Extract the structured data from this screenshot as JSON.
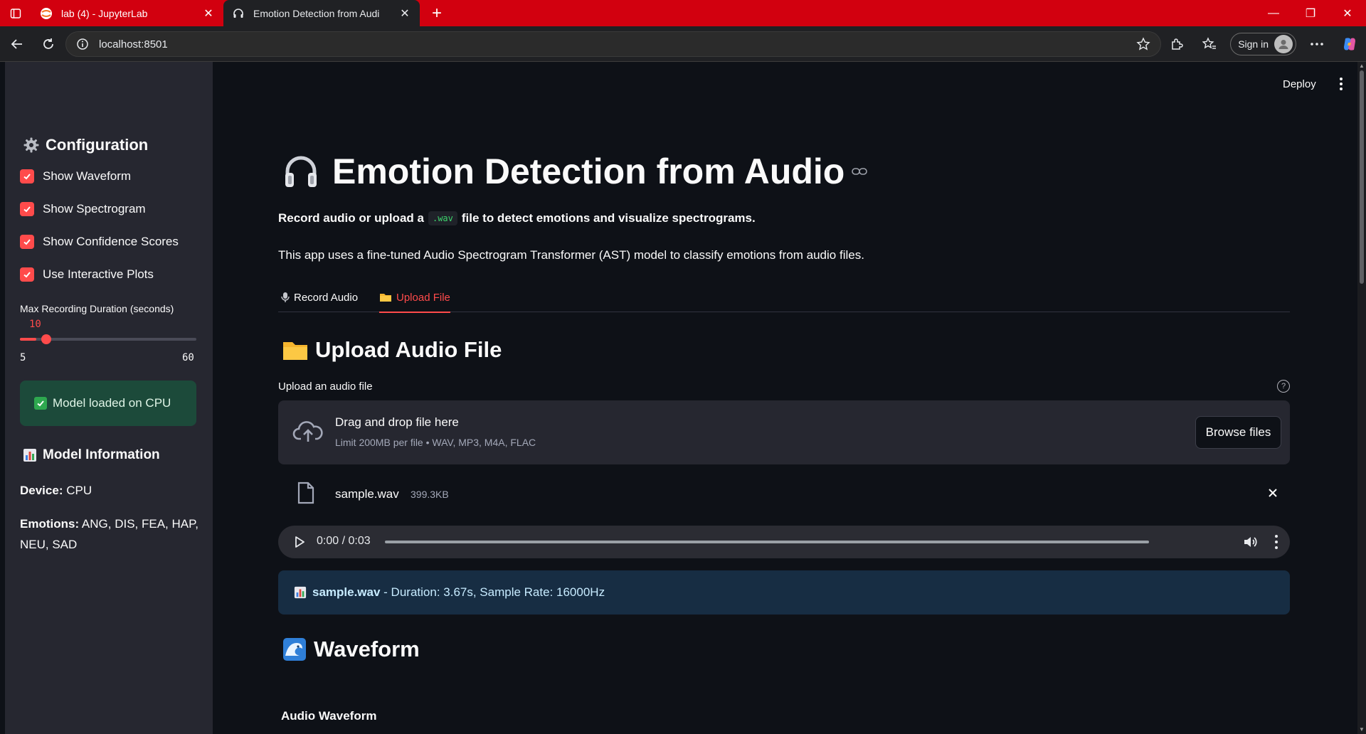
{
  "browser": {
    "tabs": [
      {
        "title": "lab (4) - JupyterLab",
        "icon": "jupyter-icon",
        "active": false
      },
      {
        "title": "Emotion Detection from Audi",
        "icon": "headphones-icon",
        "active": true
      }
    ],
    "url": "localhost:8501",
    "signin_label": "Sign in"
  },
  "header": {
    "deploy_label": "Deploy"
  },
  "sidebar": {
    "config_title": "Configuration",
    "checkboxes": [
      {
        "label": "Show Waveform",
        "checked": true
      },
      {
        "label": "Show Spectrogram",
        "checked": true
      },
      {
        "label": "Show Confidence Scores",
        "checked": true
      },
      {
        "label": "Use Interactive Plots",
        "checked": true
      }
    ],
    "slider": {
      "label": "Max Recording Duration (seconds)",
      "value": "10",
      "min": "5",
      "max": "60"
    },
    "success_message": "Model loaded on CPU",
    "model_info_title": "Model Information",
    "device_label": "Device:",
    "device_value": "CPU",
    "emotions_label": "Emotions:",
    "emotions_value_line1": "ANG, DIS, FEA, HAP,",
    "emotions_value_line2": "NEU, SAD"
  },
  "main": {
    "title": "Emotion Detection from Audio",
    "subtitle_pre": "Record audio or upload a",
    "subtitle_code": ".wav",
    "subtitle_post": "file to detect emotions and visualize spectrograms.",
    "description": "This app uses a fine-tuned Audio Spectrogram Transformer (AST) model to classify emotions from audio files.",
    "tabs": [
      {
        "label": "Record Audio",
        "icon": "microphone-icon",
        "active": false
      },
      {
        "label": "Upload File",
        "icon": "folder-icon",
        "active": true
      }
    ],
    "upload_section_title": "Upload Audio File",
    "upload_label": "Upload an audio file",
    "dropzone_title": "Drag and drop file here",
    "dropzone_limit": "Limit 200MB per file • WAV, MP3, M4A, FLAC",
    "browse_label": "Browse files",
    "file_name": "sample.wav",
    "file_size": "399.3KB",
    "player_time": "0:00 / 0:03",
    "player_progress": 0,
    "info_file": "sample.wav",
    "info_text": " - Duration: 3.67s, Sample Rate: 16000Hz",
    "waveform_title": "Waveform",
    "waveform_subtitle": "Audio Waveform"
  },
  "colors": {
    "accent": "#ff4b4b",
    "browser_red": "#d2000f",
    "background": "#0e1117",
    "sidebar": "#262730",
    "success_bg": "#1c4a3a",
    "info_bg": "#172d43"
  }
}
